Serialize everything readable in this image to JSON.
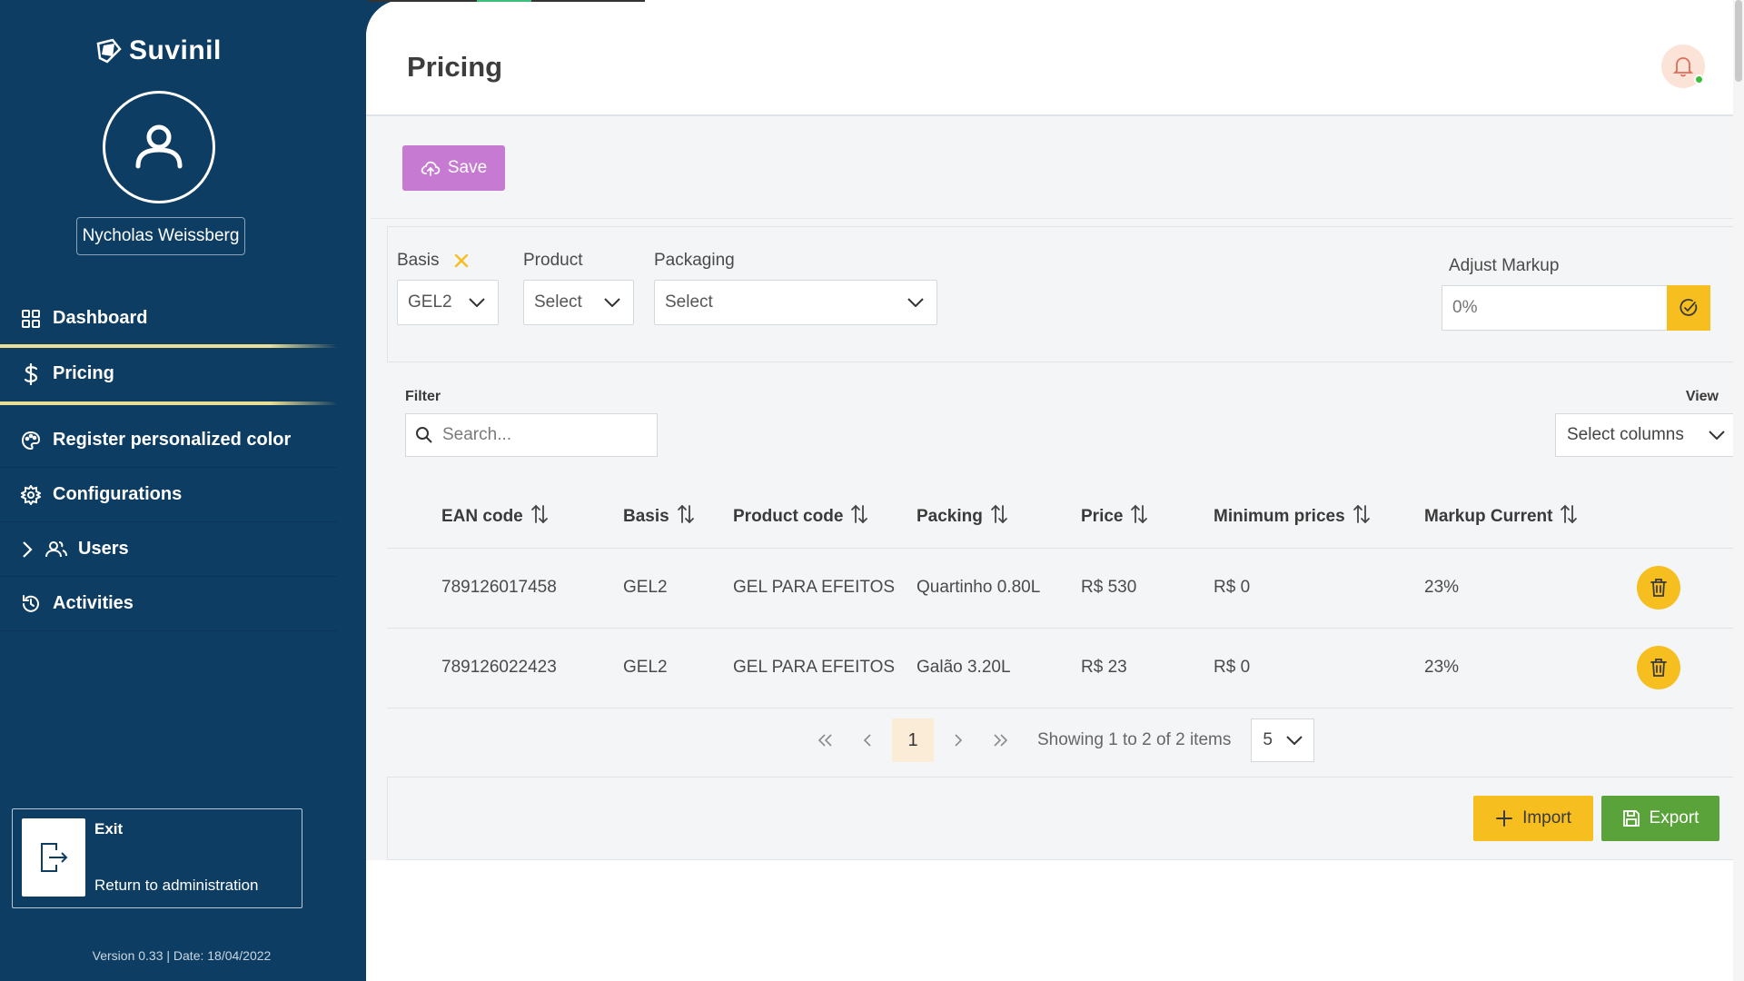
{
  "sidebar": {
    "brand": "Suvinil",
    "user_name": "Nycholas Weissberg",
    "nav": [
      {
        "label": "Dashboard",
        "icon": "grid-icon"
      },
      {
        "label": "Pricing",
        "icon": "dollar-icon",
        "active": true
      },
      {
        "label": "Register personalized color",
        "icon": "palette-icon"
      },
      {
        "label": "Configurations",
        "icon": "gear-icon"
      },
      {
        "label": "Users",
        "icon": "users-icon"
      },
      {
        "label": "Activities",
        "icon": "history-icon"
      }
    ],
    "exit": {
      "title": "Exit",
      "subtitle": "Return to administration"
    },
    "version": "Version 0.33 | Date: 18/04/2022"
  },
  "header": {
    "title": "Pricing"
  },
  "toolbar": {
    "save_label": "Save"
  },
  "filters": {
    "basis": {
      "label": "Basis",
      "value": "GEL2"
    },
    "product": {
      "label": "Product",
      "value": "Select"
    },
    "packaging": {
      "label": "Packaging",
      "value": "Select"
    },
    "adjust_markup": {
      "label": "Adjust Markup",
      "placeholder": "0%"
    }
  },
  "table_panel": {
    "filter_label": "Filter",
    "search_placeholder": "Search...",
    "view_label": "View",
    "columns_select": "Select columns"
  },
  "table": {
    "columns": [
      "EAN code",
      "Basis",
      "Product code",
      "Packing",
      "Price",
      "Minimum prices",
      "Markup Current"
    ],
    "rows": [
      [
        "789126017458",
        "GEL2",
        "GEL PARA EFEITOS",
        "Quartinho 0.80L",
        "R$ 530",
        "R$ 0",
        "23%"
      ],
      [
        "789126022423",
        "GEL2",
        "GEL PARA EFEITOS",
        "Galão 3.20L",
        "R$ 23",
        "R$ 0",
        "23%"
      ]
    ]
  },
  "pagination": {
    "current_page": "1",
    "info": "Showing 1 to 2 of 2 items",
    "page_size": "5"
  },
  "actions": {
    "import_label": "Import",
    "export_label": "Export"
  },
  "colors": {
    "sidebar": "#0e3d63",
    "save": "#c67ad1",
    "accent_yellow": "#f6be1f",
    "export_green": "#5aa33a"
  }
}
